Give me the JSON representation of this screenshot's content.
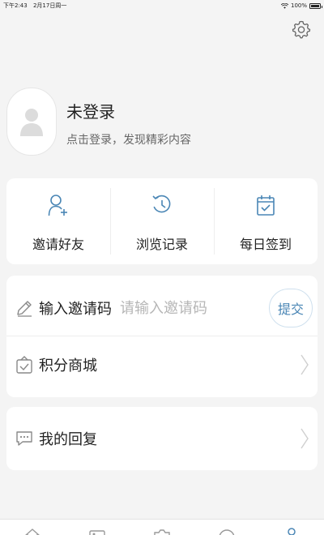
{
  "status_bar": {
    "time": "下午2:43",
    "date": "2月17日周一",
    "battery": "100%"
  },
  "profile": {
    "title": "未登录",
    "subtitle": "点击登录，发现精彩内容"
  },
  "quick_actions": [
    {
      "label": "邀请好友",
      "icon": "add-user-icon"
    },
    {
      "label": "浏览记录",
      "icon": "history-icon"
    },
    {
      "label": "每日签到",
      "icon": "calendar-check-icon"
    }
  ],
  "invite": {
    "label": "输入邀请码",
    "placeholder": "请输入邀请码",
    "submit": "提交"
  },
  "points_mall": {
    "label": "积分商城"
  },
  "my_replies": {
    "label": "我的回复"
  },
  "colors": {
    "accent": "#4a86b5",
    "background": "#f4f4f4",
    "card": "#ffffff"
  },
  "tabs": [
    "home-icon",
    "video-icon",
    "camera-icon",
    "discover-icon",
    "profile-icon"
  ]
}
